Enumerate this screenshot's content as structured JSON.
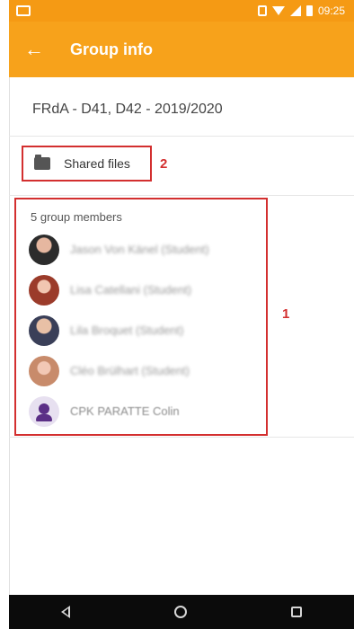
{
  "status_bar": {
    "time": "09:25",
    "icons": [
      "image-icon",
      "vibrate-icon",
      "wifi-icon",
      "signal-icon",
      "battery-icon"
    ]
  },
  "app_bar": {
    "title": "Group info",
    "back_icon": "arrow-left-icon",
    "back_glyph": "←"
  },
  "group": {
    "name": "FRdA - D41, D42 - 2019/2020"
  },
  "shared_files": {
    "label": "Shared files",
    "icon": "folder-shared-icon",
    "annotation": "2"
  },
  "members": {
    "heading": "5 group members",
    "annotation": "1",
    "items": [
      {
        "name": "Jason Von Känel (Student)",
        "avatar": "photo"
      },
      {
        "name": "Lisa Catellani (Student)",
        "avatar": "photo"
      },
      {
        "name": "Lila Broquet (Student)",
        "avatar": "photo"
      },
      {
        "name": "Cléo Brülhart (Student)",
        "avatar": "photo"
      },
      {
        "name": "CPK PARATTE Colin",
        "avatar": "person-icon"
      }
    ]
  },
  "colors": {
    "primary": "#f7a21b",
    "status_bar": "#f59a14",
    "annotation_red": "#d32f2f",
    "generic_avatar": "#5b2f86"
  },
  "nav_bar": {
    "icons": [
      "nav-back-icon",
      "nav-home-icon",
      "nav-recents-icon"
    ]
  }
}
